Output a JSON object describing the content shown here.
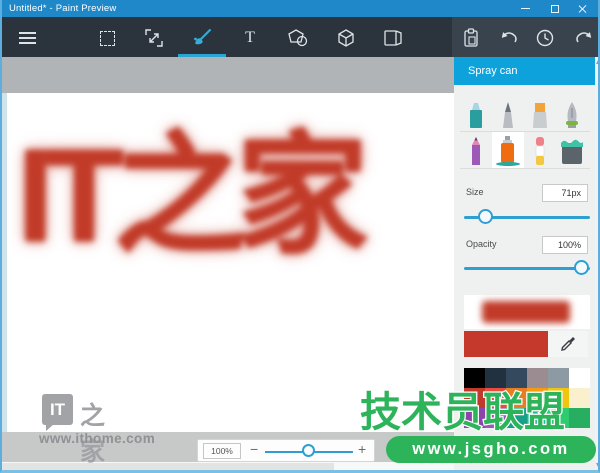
{
  "titlebar": {
    "title": "Untitled* - Paint Preview"
  },
  "toolbar": {
    "text_tool_glyph": "T"
  },
  "panel": {
    "header": "Spray can",
    "size_label": "Size",
    "size_value": "71px",
    "opacity_label": "Opacity",
    "opacity_value": "100%",
    "current_color": "#c4392b",
    "accent_color": "#0da2dc",
    "slider_color": "#2e9fd0",
    "tools": [
      "highlighter",
      "calligraphy-pen",
      "marker",
      "fountain-pen",
      "pencil",
      "spray-can",
      "glue-stick",
      "paint-bucket"
    ],
    "selected_tool": "spray-can",
    "palette": {
      "rows": [
        [
          "#000000",
          "#22313f",
          "#34495e",
          "#9a8c90",
          "#8d9aa3",
          "#ffffff"
        ],
        [
          "#c0392b",
          "#e74c3c",
          "#e67e22",
          "#f39c12",
          "#f1c40f",
          "#fbf0ce"
        ],
        [
          "#8e44ad",
          "#9b59b6",
          "#16a085",
          "#1abc9c",
          "#2ecc71",
          "#27ae60"
        ]
      ]
    }
  },
  "canvas": {
    "spray_text": "IT之家",
    "spray_color": "#c23b29"
  },
  "statusbar": {
    "zoom_value": "100%",
    "minus": "−",
    "plus": "+"
  },
  "watermarks": {
    "ithome": {
      "logo_it": "IT",
      "logo_suffix": "之家",
      "url": "www.ithome.com"
    },
    "jsgho": {
      "title": "技术员联盟",
      "url": "www.jsgho.com"
    }
  }
}
